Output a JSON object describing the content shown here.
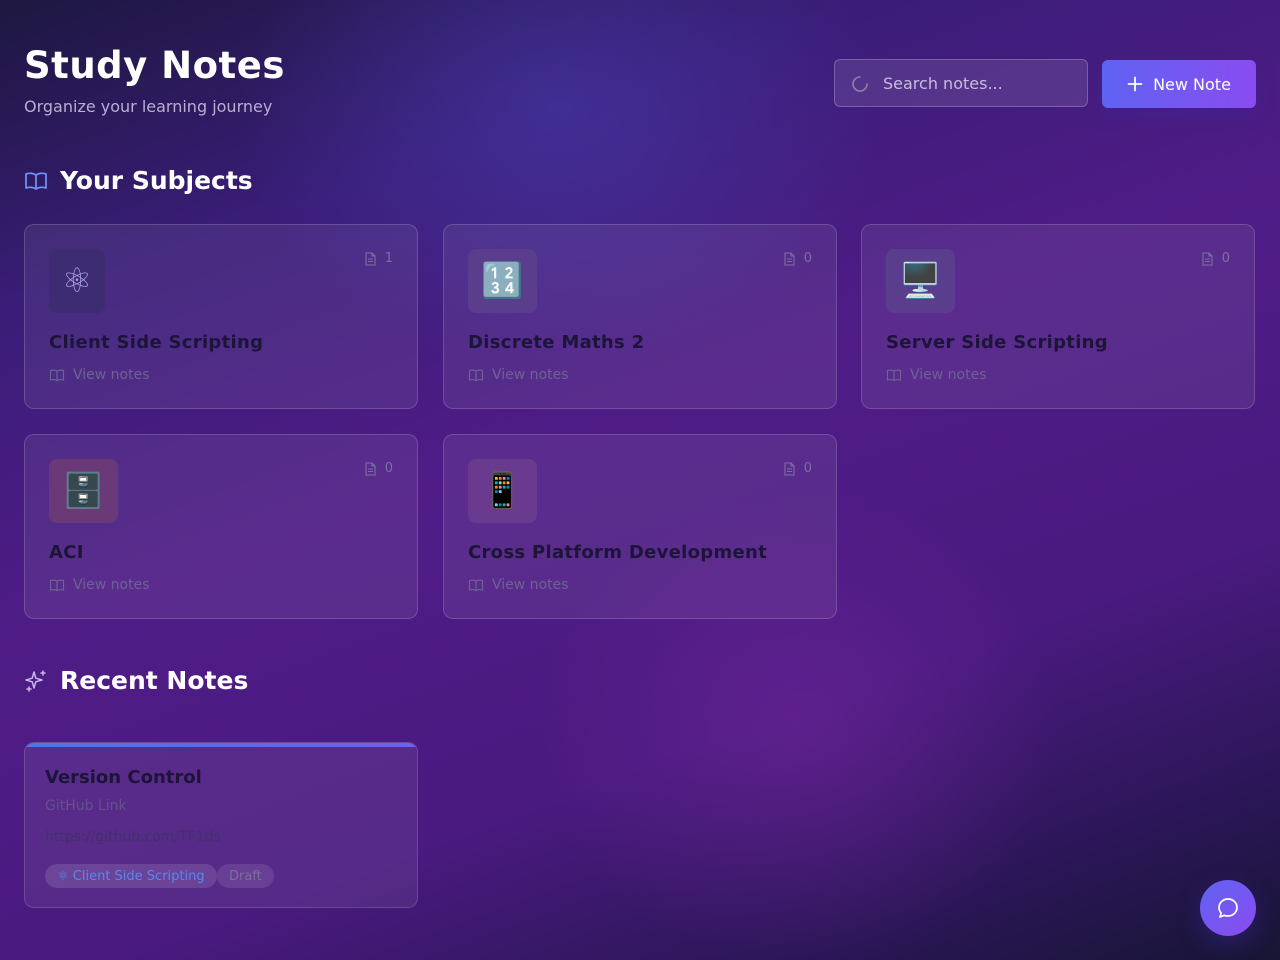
{
  "header": {
    "title": "Study Notes",
    "subtitle": "Organize your learning journey"
  },
  "search": {
    "placeholder": "Search notes...",
    "value": ""
  },
  "toolbar": {
    "new_note_label": "New Note",
    "new_note_icon": "plus-icon"
  },
  "subjects_section": {
    "heading": "Your Subjects",
    "icon": "book-open-icon",
    "items": [
      {
        "name": "Client Side Scripting",
        "icon": "⚛",
        "count": "1",
        "view_label": "View notes",
        "icon_bg": "#3e2c72"
      },
      {
        "name": "Discrete Maths 2",
        "icon": "🔢",
        "count": "0",
        "view_label": "View notes",
        "icon_bg": "#5a3d8c"
      },
      {
        "name": "Server Side Scripting",
        "icon": "🖥️",
        "count": "0",
        "view_label": "View notes",
        "icon_bg": "#5a3d8c"
      },
      {
        "name": "ACI",
        "icon": "🗄️",
        "count": "0",
        "view_label": "View notes",
        "icon_bg": "#6a3a78"
      },
      {
        "name": "Cross Platform Development",
        "icon": "📱",
        "count": "0",
        "view_label": "View notes",
        "icon_bg": "#6a3a8e"
      }
    ]
  },
  "recent_section": {
    "heading": "Recent Notes",
    "icon": "sparkles-icon",
    "items": [
      {
        "title": "Version Control",
        "subtitle": "GitHub Link",
        "content": "https://github.com/TF1ds",
        "subject_tag": "⚛ Client Side Scripting",
        "status_tag": "Draft"
      }
    ]
  },
  "chat": {
    "icon": "chat-bubble-icon"
  },
  "colors": {
    "accent_start": "#5f63f2",
    "accent_end": "#8a4cf1",
    "tag_blue": "#5a86f0"
  }
}
